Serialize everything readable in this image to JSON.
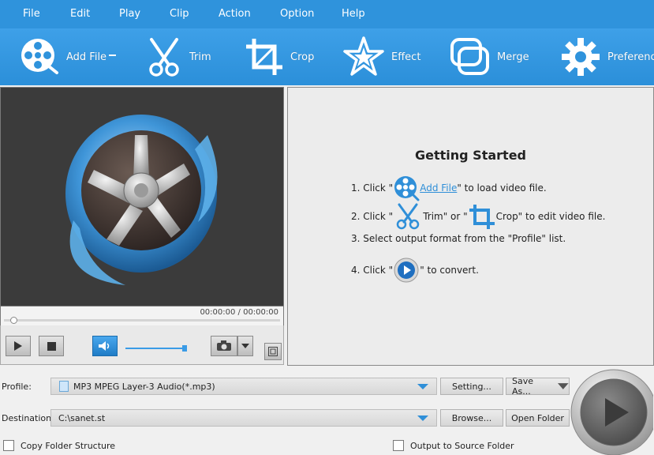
{
  "menu": {
    "items": [
      "File",
      "Edit",
      "Play",
      "Clip",
      "Action",
      "Option",
      "Help"
    ]
  },
  "toolbar": {
    "add_file": "Add File",
    "trim": "Trim",
    "crop": "Crop",
    "effect": "Effect",
    "merge": "Merge",
    "preferences": "Preferences"
  },
  "player": {
    "time": "00:00:00 / 00:00:00",
    "seek_fraction": 0.0,
    "volume_fraction": 0.95
  },
  "guide": {
    "title": "Getting Started",
    "step1_prefix": "1. Click \"",
    "step1_link": " Add File ",
    "step1_suffix": "\" to load video file.",
    "step2_prefix": "2. Click \"",
    "step2_trim": " Trim\" or \"",
    "step2_suffix": " Crop\" to edit video file.",
    "step3": "3. Select output format from the \"Profile\" list.",
    "step4_prefix": "4. Click \"",
    "step4_suffix": "\" to convert."
  },
  "profile": {
    "label": "Profile:",
    "value": "MP3 MPEG Layer-3 Audio(*.mp3)",
    "setting_button": "Setting...",
    "save_as_button": "Save As..."
  },
  "destination": {
    "label": "Destination:",
    "value": "C:\\sanet.st",
    "browse_button": "Browse...",
    "open_folder_button": "Open Folder"
  },
  "options": {
    "copy_folder_structure": "Copy Folder Structure",
    "output_to_source_folder": "Output to Source Folder"
  },
  "colors": {
    "accent": "#2f93dc",
    "link": "#2f8fd8"
  }
}
